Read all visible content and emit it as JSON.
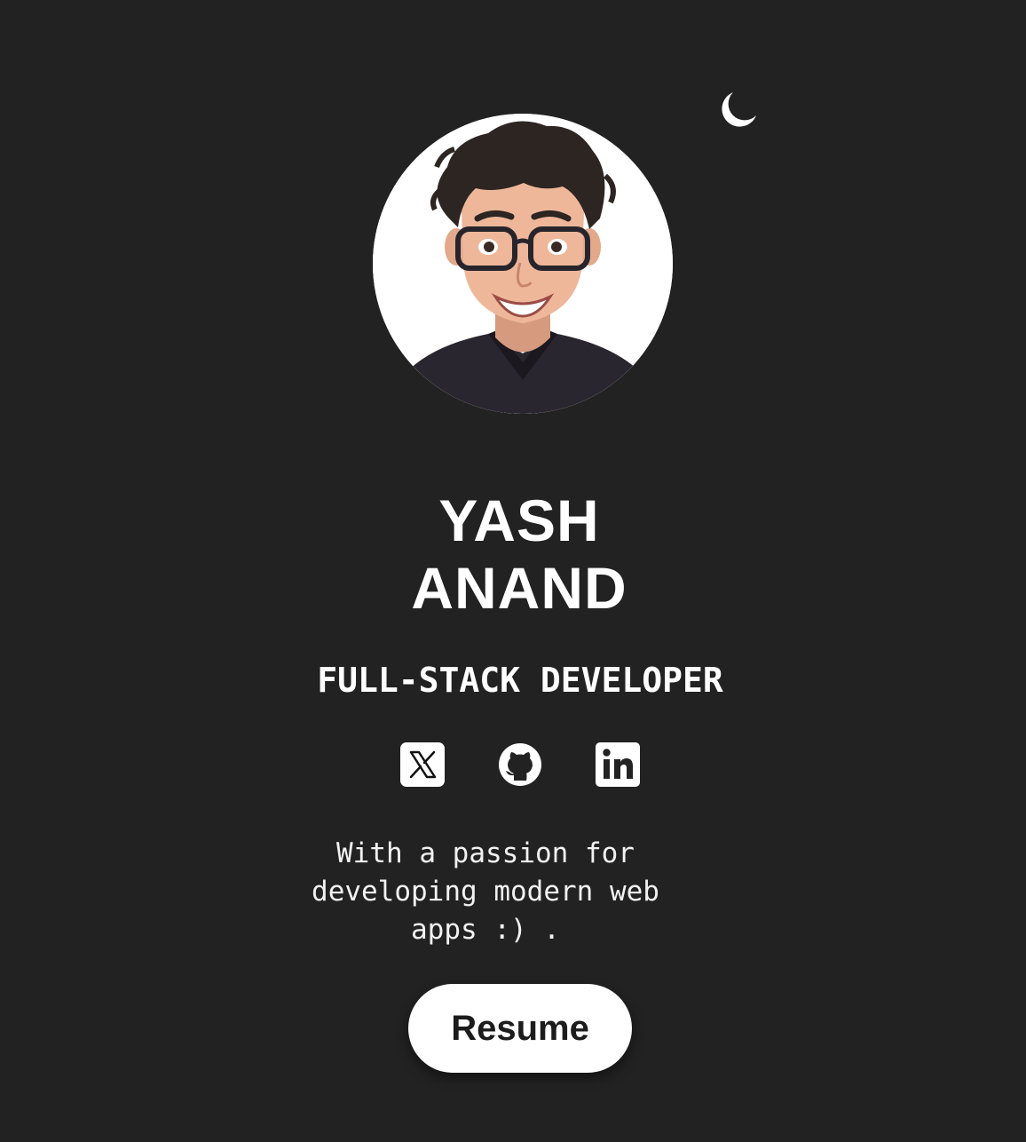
{
  "profile": {
    "first_name": "YASH",
    "last_name": "ANAND",
    "role": "FULL-STACK DEVELOPER",
    "bio": "With a passion for developing modern web apps :) ."
  },
  "socials": [
    {
      "icon": "x-twitter-icon"
    },
    {
      "icon": "github-icon"
    },
    {
      "icon": "linkedin-icon"
    }
  ],
  "actions": {
    "resume_label": "Resume",
    "theme_toggle_icon": "moon-icon"
  },
  "colors": {
    "background": "#222222",
    "text": "#ffffff",
    "button_bg": "#ffffff",
    "button_text": "#1c1c1c"
  }
}
